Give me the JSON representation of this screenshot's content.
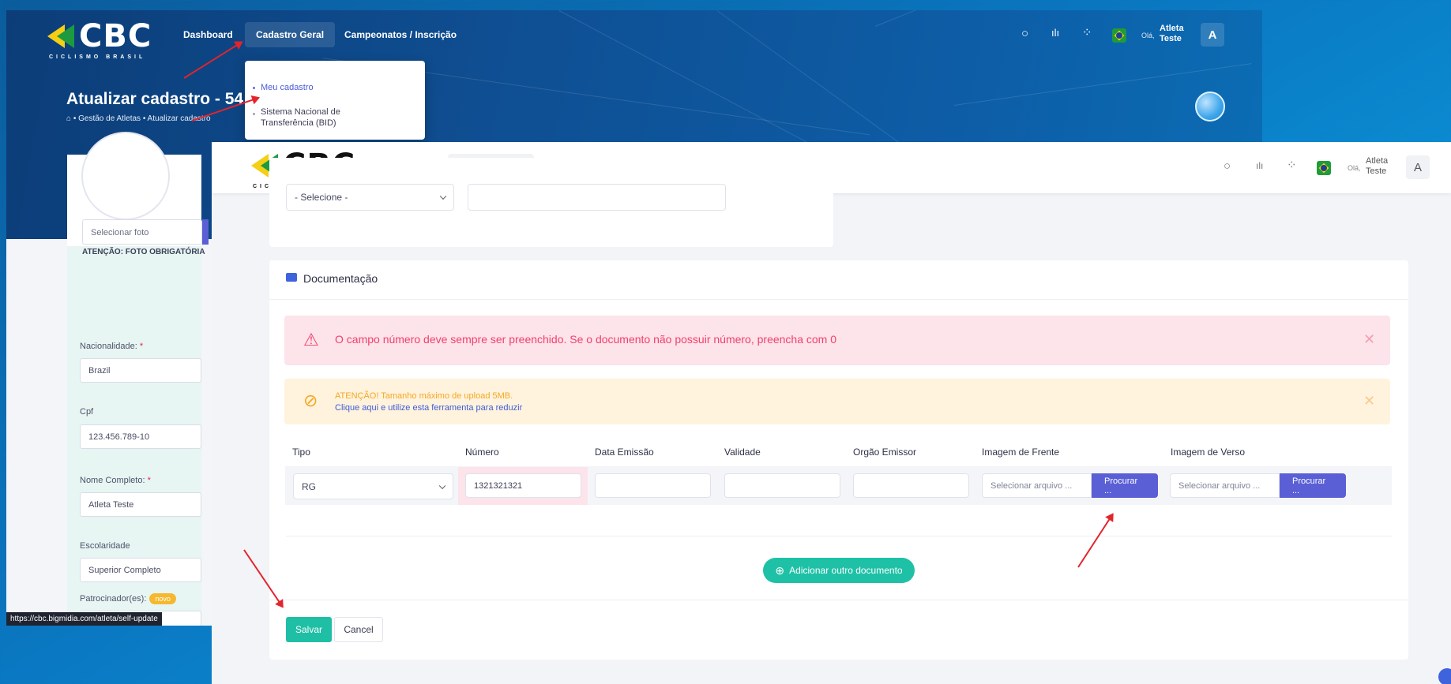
{
  "brand": {
    "name": "CBC",
    "tagline": "CICLISMO BRASIL",
    "colors": {
      "green": "#1d9a3f",
      "yellow": "#f4cf14",
      "blue": "#1a3e8f"
    }
  },
  "nav": {
    "dashboard": "Dashboard",
    "cadastro": "Cadastro Geral",
    "campeonatos": "Campeonatos / Inscrição"
  },
  "user": {
    "greeting": "Olá,",
    "first": "Atleta",
    "last": "Teste",
    "initial": "A"
  },
  "dropdown": {
    "items": [
      "Meu cadastro",
      "Sistema Nacional de Transferência (BID)"
    ]
  },
  "back": {
    "title": "Atualizar cadastro - 54",
    "breadcrumb": "• Gestão de Atletas • Atualizar cadastro",
    "select_photo": "Selecionar foto",
    "photo_warning": "ATENÇÃO: FOTO OBRIGATÓRIA",
    "fields": [
      {
        "label": "Nacionalidade:",
        "required": "*",
        "value": "Brazil"
      },
      {
        "label": "Cpf",
        "required": "",
        "value": "123.456.789-10"
      },
      {
        "label": "Nome Completo:",
        "required": "*",
        "value": "Atleta Teste"
      },
      {
        "label": "Escolaridade",
        "required": "",
        "value": "Superior Completo"
      }
    ],
    "sponsors_label": "Patrocinador(es):",
    "new_badge": "novo",
    "status_url": "https://cbc.bigmidia.com/atleta/self-update"
  },
  "front": {
    "select_placeholder": "- Selecione -",
    "section_title": "Documentação",
    "alert_error": "O campo número deve sempre ser preenchido. Se o documento não possuir número, preencha com 0",
    "alert_warning_line1": "ATENÇÃO! Tamanho máximo de upload 5MB.",
    "alert_warning_line2": "Clique aqui e utilize esta ferramenta para reduzir",
    "columns": [
      "Tipo",
      "Número",
      "Data Emissão",
      "Validade",
      "Orgão Emissor",
      "Imagem de Frente",
      "Imagem de Verso"
    ],
    "row": {
      "tipo": "RG",
      "numero": "1321321321",
      "data_emissao": "",
      "validade": "",
      "orgao_emissor": "",
      "file_placeholder": "Selecionar arquivo ...",
      "browse": "Procurar ..."
    },
    "add_doc": "Adicionar outro documento",
    "save": "Salvar",
    "cancel": "Cancel"
  }
}
